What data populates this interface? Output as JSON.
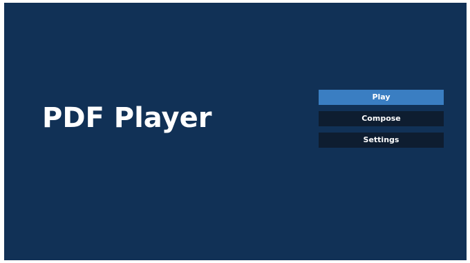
{
  "app": {
    "title": "PDF Player"
  },
  "menu": {
    "items": [
      {
        "label": "Play",
        "selected": true
      },
      {
        "label": "Compose",
        "selected": false
      },
      {
        "label": "Settings",
        "selected": false
      }
    ]
  },
  "colors": {
    "background": "#113156",
    "button": "#0e1d30",
    "button_selected": "#3a7ec2",
    "text": "#ffffff"
  }
}
